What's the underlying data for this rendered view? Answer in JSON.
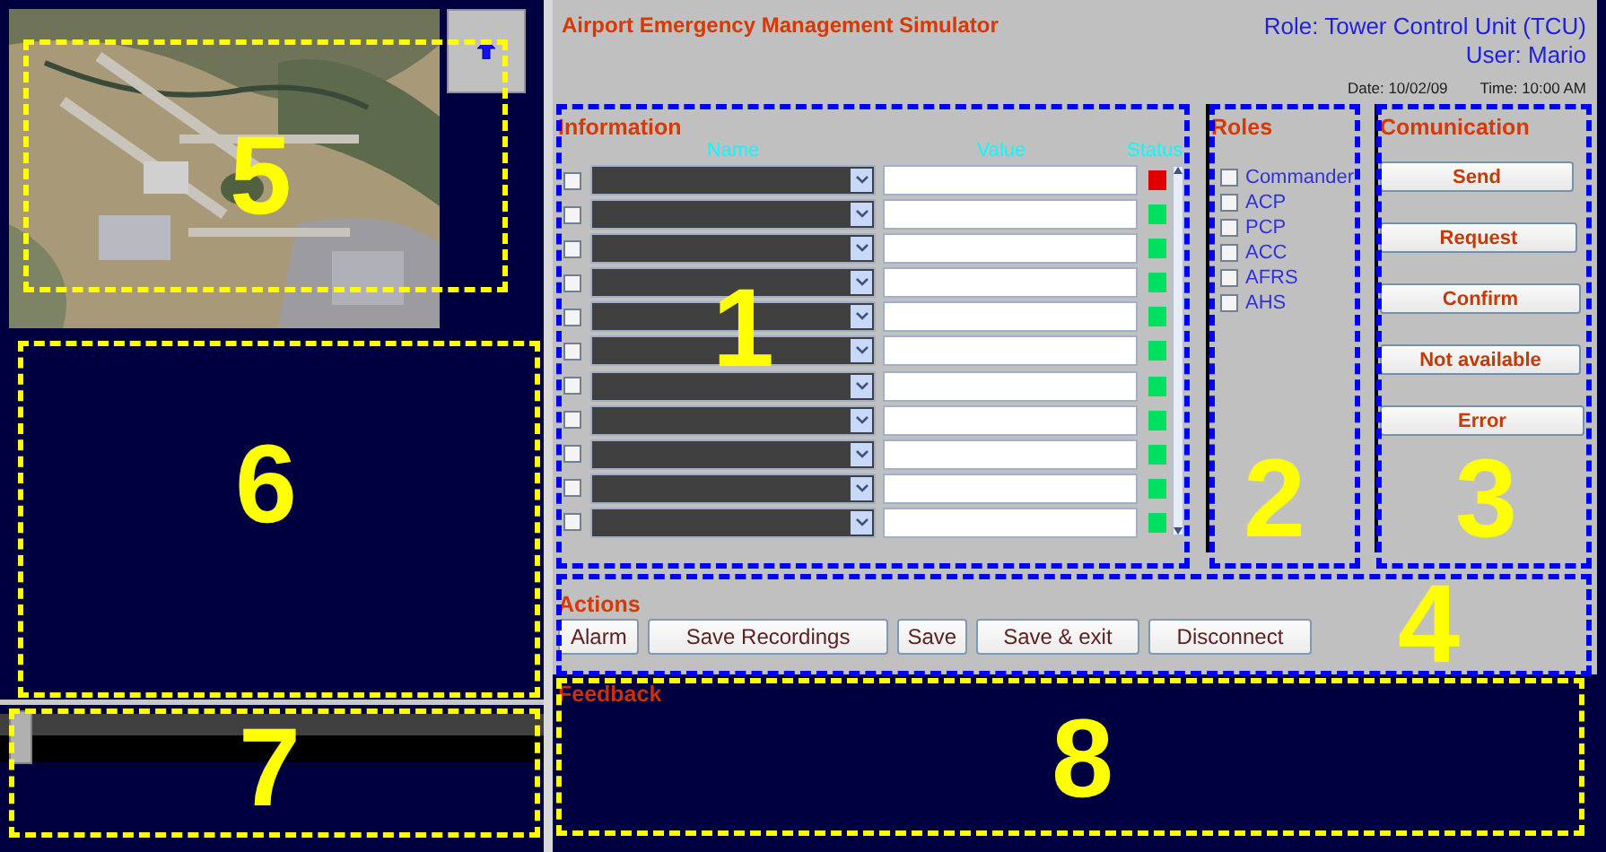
{
  "header": {
    "title": "Airport Emergency Management Simulator",
    "role": "Role: Tower Control Unit (TCU)",
    "user": "User: Mario",
    "date": "Date: 10/02/09",
    "time": "Time: 10:00 AM"
  },
  "information": {
    "title": "Information",
    "columns": [
      "Name",
      "Value",
      "Status"
    ],
    "rows": [
      {
        "checked": false,
        "color": "#e00000"
      },
      {
        "checked": false,
        "color": "#00e060"
      },
      {
        "checked": false,
        "color": "#00e060"
      },
      {
        "checked": false,
        "color": "#00e060"
      },
      {
        "checked": false,
        "color": "#00e060"
      },
      {
        "checked": false,
        "color": "#00e060"
      },
      {
        "checked": false,
        "color": "#00e060"
      },
      {
        "checked": false,
        "color": "#00e060"
      },
      {
        "checked": false,
        "color": "#00e060"
      },
      {
        "checked": false,
        "color": "#00e060"
      },
      {
        "checked": false,
        "color": "#00e060"
      }
    ]
  },
  "roles": {
    "title": "Roles",
    "items": [
      {
        "label": "Commander",
        "checked": false
      },
      {
        "label": "ACP",
        "checked": false
      },
      {
        "label": "PCP",
        "checked": false
      },
      {
        "label": "ACC",
        "checked": false
      },
      {
        "label": "AFRS",
        "checked": false
      },
      {
        "label": "AHS",
        "checked": false
      }
    ]
  },
  "communication": {
    "title": "Comunication",
    "buttons": [
      "Send",
      "Request",
      "Confirm",
      "Not available",
      "Error"
    ]
  },
  "actions": {
    "title": "Actions",
    "buttons": [
      "Alarm",
      "Save Recordings",
      "Save",
      "Save & exit",
      "Disconnect"
    ]
  },
  "feedback": {
    "title": "Feedback"
  },
  "annotations": [
    {
      "label": "5",
      "color": "#ffff00"
    },
    {
      "label": "6",
      "color": "#ffff00"
    },
    {
      "label": "7",
      "color": "#ffff00"
    },
    {
      "label": "8",
      "color": "#ffff00"
    },
    {
      "label": "1",
      "color": "#0000ff"
    },
    {
      "label": "2",
      "color": "#0000ff"
    },
    {
      "label": "3",
      "color": "#0000ff"
    },
    {
      "label": "4",
      "color": "#0000ff"
    }
  ]
}
